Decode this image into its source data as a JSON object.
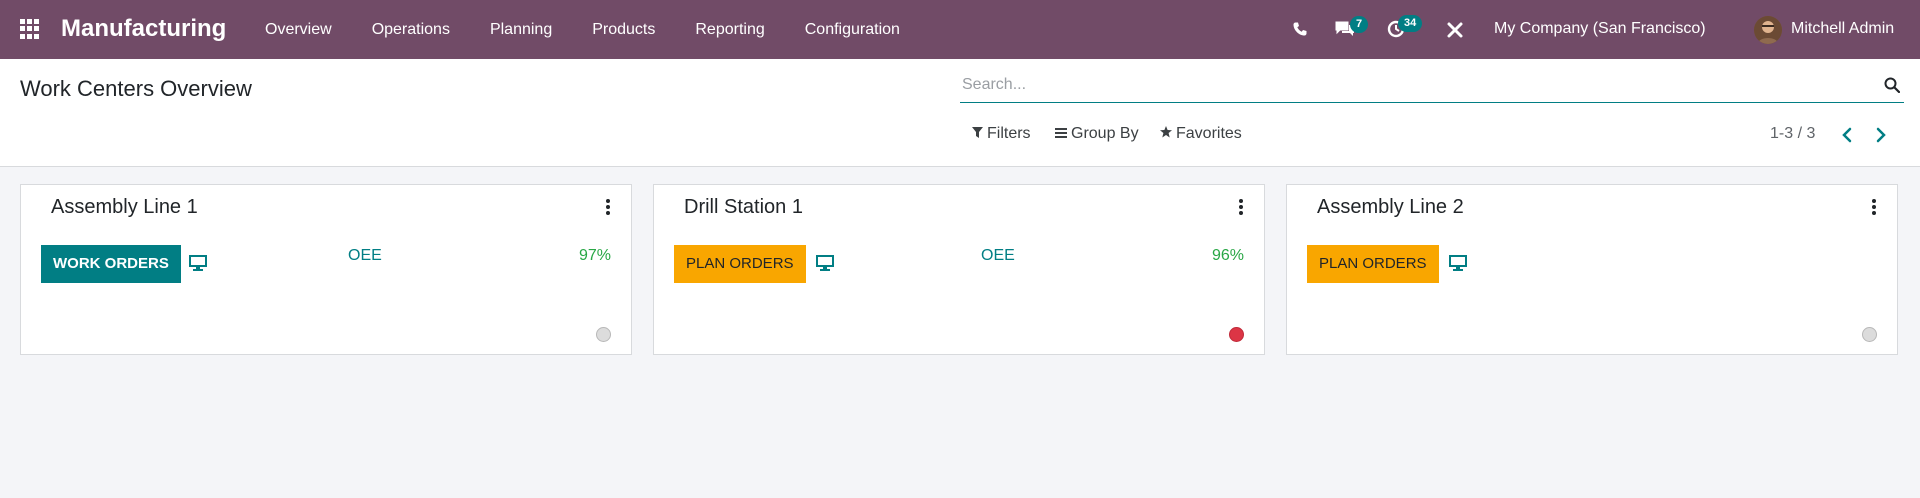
{
  "navbar": {
    "app_name": "Manufacturing",
    "menu": [
      {
        "label": "Overview"
      },
      {
        "label": "Operations"
      },
      {
        "label": "Planning"
      },
      {
        "label": "Products"
      },
      {
        "label": "Reporting"
      },
      {
        "label": "Configuration"
      }
    ],
    "messages_badge": "7",
    "activities_badge": "34",
    "company": "My Company (San Francisco)",
    "user": "Mitchell Admin",
    "bg_color": "#714b67"
  },
  "control_panel": {
    "title": "Work Centers Overview",
    "search_placeholder": "Search...",
    "filters_label": "Filters",
    "group_by_label": "Group By",
    "favorites_label": "Favorites",
    "pager": "1-3 / 3"
  },
  "cards": [
    {
      "title": "Assembly Line 1",
      "button": "WORK ORDERS",
      "button_style": "teal",
      "oee_label": "OEE",
      "oee_value": "97%",
      "status_color": "#dcdcdc"
    },
    {
      "title": "Drill Station 1",
      "button": "PLAN ORDERS",
      "button_style": "orange",
      "oee_label": "OEE",
      "oee_value": "96%",
      "status_color": "#dc3545"
    },
    {
      "title": "Assembly Line 2",
      "button": "PLAN ORDERS",
      "button_style": "orange",
      "status_color": "#dcdcdc"
    }
  ]
}
